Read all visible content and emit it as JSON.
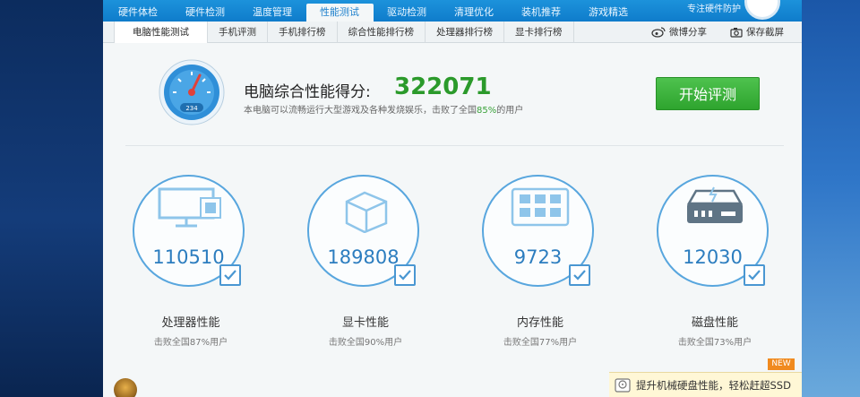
{
  "nav": {
    "items": [
      "硬件体检",
      "硬件检测",
      "温度管理",
      "性能测试",
      "驱动检测",
      "清理优化",
      "装机推荐",
      "游戏精选"
    ],
    "active_index": 3,
    "slogan": "专注硬件防护"
  },
  "subtabs": {
    "items": [
      "电脑性能测试",
      "手机评测",
      "手机排行榜",
      "综合性能排行榜",
      "处理器排行榜",
      "显卡排行榜"
    ],
    "active_index": 0,
    "share_label": "微博分享",
    "screenshot_label": "保存截屏"
  },
  "score": {
    "title": "电脑综合性能得分:",
    "value": "322071",
    "gauge_text": "234",
    "desc_prefix": "本电脑可以流畅运行大型游戏及各种发烧娱乐，击败了全国",
    "desc_pct": "85%",
    "desc_suffix": "的用户",
    "start_button": "开始评测"
  },
  "cards": [
    {
      "score": "110510",
      "label": "处理器性能",
      "beat": "击败全国87%用户",
      "icon": "cpu-monitor-icon"
    },
    {
      "score": "189808",
      "label": "显卡性能",
      "beat": "击败全国90%用户",
      "icon": "graphics-cube-icon"
    },
    {
      "score": "9723",
      "label": "内存性能",
      "beat": "击败全国77%用户",
      "icon": "memory-chip-icon"
    },
    {
      "score": "12030",
      "label": "磁盘性能",
      "beat": "击败全国73%用户",
      "icon": "disk-drive-icon"
    }
  ],
  "banner": {
    "new_badge": "NEW",
    "text": "提升机械硬盘性能，轻松赶超SSD"
  },
  "colors": {
    "nav_blue": "#0f7ccb",
    "score_green": "#2b9a2b",
    "ring_blue": "#58a6de",
    "button_green": "#2ea42e"
  }
}
